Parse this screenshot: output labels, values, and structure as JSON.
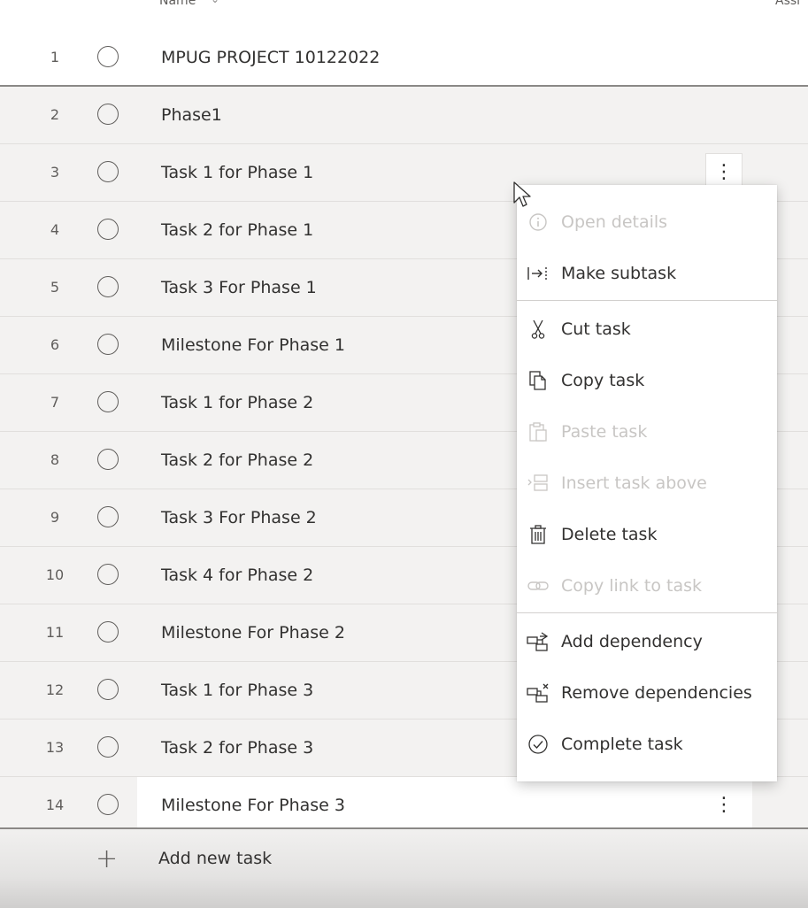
{
  "header": {
    "name_label": "Name",
    "name_sort_icon": "chevron-down-icon",
    "assigned_label": "Assi"
  },
  "rows": [
    {
      "num": "1",
      "title": "MPUG PROJECT 10122022"
    },
    {
      "num": "2",
      "title": "Phase1"
    },
    {
      "num": "3",
      "title": "Task 1 for Phase 1"
    },
    {
      "num": "4",
      "title": "Task 2 for Phase 1"
    },
    {
      "num": "5",
      "title": "Task 3 For Phase 1"
    },
    {
      "num": "6",
      "title": "Milestone For Phase 1"
    },
    {
      "num": "7",
      "title": "Task 1 for Phase 2"
    },
    {
      "num": "8",
      "title": "Task 2 for Phase 2"
    },
    {
      "num": "9",
      "title": "Task 3 For Phase 2"
    },
    {
      "num": "10",
      "title": "Task 4 for Phase 2"
    },
    {
      "num": "11",
      "title": "Milestone For Phase 2"
    },
    {
      "num": "12",
      "title": "Task 1 for Phase 3"
    },
    {
      "num": "13",
      "title": "Task 2 for Phase 3"
    },
    {
      "num": "14",
      "title": "Milestone For Phase 3"
    }
  ],
  "row_more_glyph": "⋮",
  "footer": {
    "add_label": "Add new task",
    "plus_glyph": "+"
  },
  "context_menu": {
    "items": [
      {
        "label": "Open details",
        "icon": "info-icon",
        "enabled": false
      },
      {
        "label": "Make subtask",
        "icon": "indent-icon",
        "enabled": true
      },
      {
        "label": "Cut task",
        "icon": "scissors-icon",
        "enabled": true
      },
      {
        "label": "Copy task",
        "icon": "copy-icon",
        "enabled": true
      },
      {
        "label": "Paste task",
        "icon": "paste-icon",
        "enabled": false
      },
      {
        "label": "Insert task above",
        "icon": "insert-above-icon",
        "enabled": false
      },
      {
        "label": "Delete task",
        "icon": "trash-icon",
        "enabled": true
      },
      {
        "label": "Copy link to task",
        "icon": "link-icon",
        "enabled": false
      },
      {
        "label": "Add dependency",
        "icon": "add-dependency-icon",
        "enabled": true
      },
      {
        "label": "Remove dependencies",
        "icon": "remove-dependency-icon",
        "enabled": true
      },
      {
        "label": "Complete task",
        "icon": "check-circle-icon",
        "enabled": true
      }
    ]
  },
  "colors": {
    "text": "#323130",
    "muted": "#605e5c",
    "disabled": "#c8c6c4",
    "row_bg": "#f3f2f1"
  }
}
